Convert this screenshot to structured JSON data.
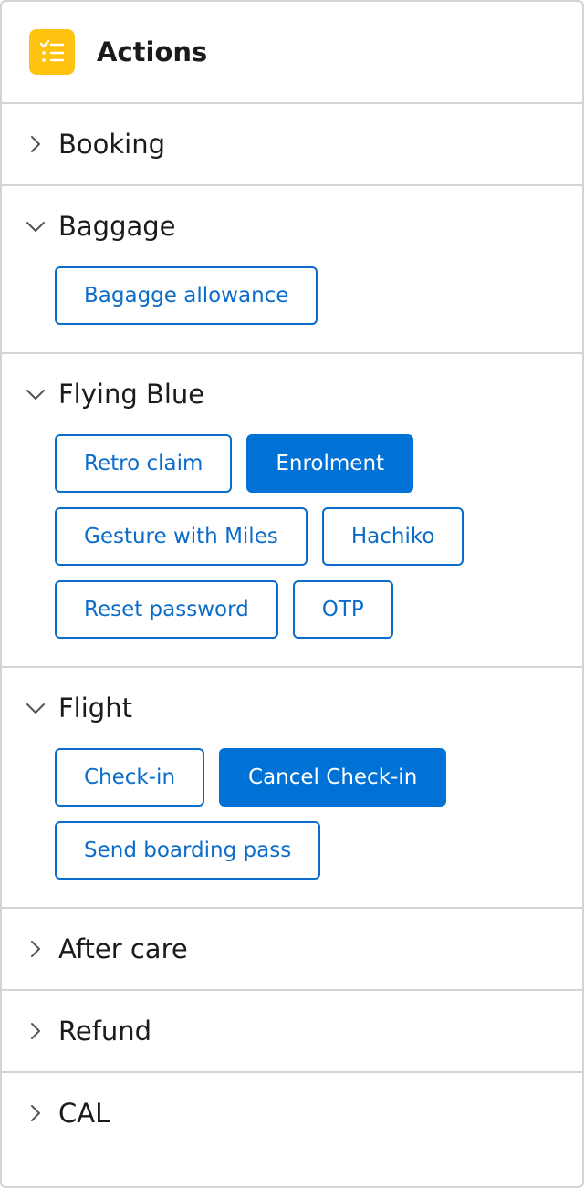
{
  "header": {
    "title": "Actions",
    "icon": "checklist-icon"
  },
  "colors": {
    "accent": "#0072D6",
    "icon_bg": "#FFC20E",
    "border": "#D4D4D4"
  },
  "sections": [
    {
      "label": "Booking",
      "expanded": false,
      "actions": []
    },
    {
      "label": "Baggage",
      "expanded": true,
      "actions": [
        {
          "label": "Bagagge allowance",
          "primary": false
        }
      ]
    },
    {
      "label": "Flying Blue",
      "expanded": true,
      "actions": [
        {
          "label": "Retro claim",
          "primary": false
        },
        {
          "label": "Enrolment",
          "primary": true
        },
        {
          "label": "Gesture with Miles",
          "primary": false
        },
        {
          "label": "Hachiko",
          "primary": false
        },
        {
          "label": "Reset password",
          "primary": false
        },
        {
          "label": "OTP",
          "primary": false
        }
      ]
    },
    {
      "label": "Flight",
      "expanded": true,
      "actions": [
        {
          "label": "Check-in",
          "primary": false
        },
        {
          "label": "Cancel Check-in",
          "primary": true
        },
        {
          "label": "Send boarding pass",
          "primary": false
        }
      ]
    },
    {
      "label": "After care",
      "expanded": false,
      "actions": []
    },
    {
      "label": "Refund",
      "expanded": false,
      "actions": []
    },
    {
      "label": "CAL",
      "expanded": false,
      "actions": []
    }
  ]
}
